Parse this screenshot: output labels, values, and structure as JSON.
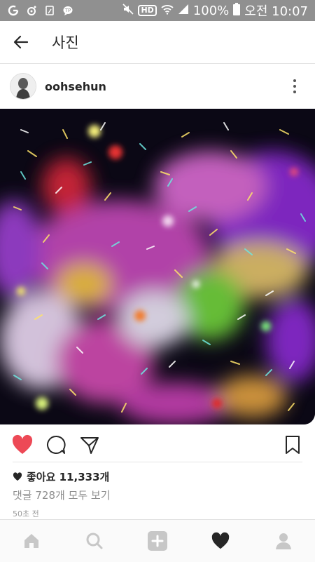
{
  "status": {
    "battery": "100%",
    "time": "오전 10:07",
    "hd_label": "HD",
    "icons": [
      "app-icon",
      "gear-icon",
      "clipboard-icon",
      "messenger-icon",
      "mute-icon",
      "hd-icon",
      "wifi-icon",
      "signal-icon",
      "battery-icon"
    ]
  },
  "appbar": {
    "title": "사진"
  },
  "post": {
    "username": "oohsehun",
    "likes": "좋아요 11,333개",
    "comments": "댓글 728개 모두 보기",
    "time": "50초 전"
  },
  "colors": {
    "like_red": "#ed4956",
    "text": "#262626",
    "muted": "#8e8e8e",
    "tab_icon": "#c7c7c7"
  }
}
